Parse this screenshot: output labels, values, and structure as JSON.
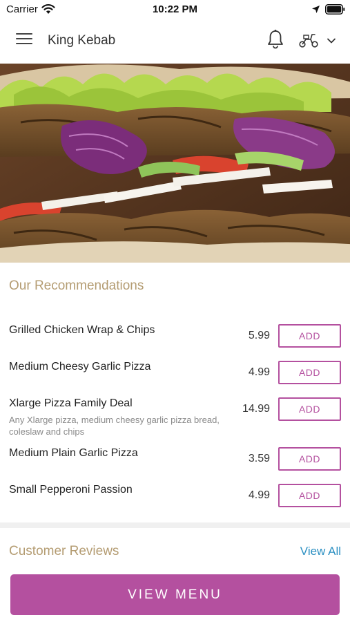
{
  "status_bar": {
    "carrier": "Carrier",
    "time": "10:22 PM"
  },
  "header": {
    "title": "King Kebab",
    "icons": [
      "menu-icon",
      "bell-icon",
      "scooter-icon",
      "chevron-down-icon"
    ]
  },
  "hero": {
    "image": "kebab-photo"
  },
  "recommendations": {
    "title": "Our Recommendations",
    "items": [
      {
        "name": "Grilled Chicken Wrap & Chips",
        "description": "",
        "price": "5.99",
        "add_label": "ADD"
      },
      {
        "name": "Medium Cheesy Garlic Pizza",
        "description": "",
        "price": "4.99",
        "add_label": "ADD"
      },
      {
        "name": "Xlarge Pizza Family Deal",
        "description": "Any Xlarge pizza, medium cheesy garlic pizza bread, coleslaw and chips",
        "price": "14.99",
        "add_label": "ADD"
      },
      {
        "name": "Medium Plain Garlic Pizza",
        "description": "",
        "price": "3.59",
        "add_label": "ADD"
      },
      {
        "name": "Small Pepperoni Passion",
        "description": "",
        "price": "4.99",
        "add_label": "ADD"
      }
    ]
  },
  "reviews": {
    "title": "Customer Reviews",
    "view_all_label": "View All"
  },
  "footer": {
    "view_menu_label": "VIEW MENU"
  },
  "colors": {
    "accent": "#b4509f",
    "section_title": "#b49c72",
    "link": "#2a8fc2"
  }
}
